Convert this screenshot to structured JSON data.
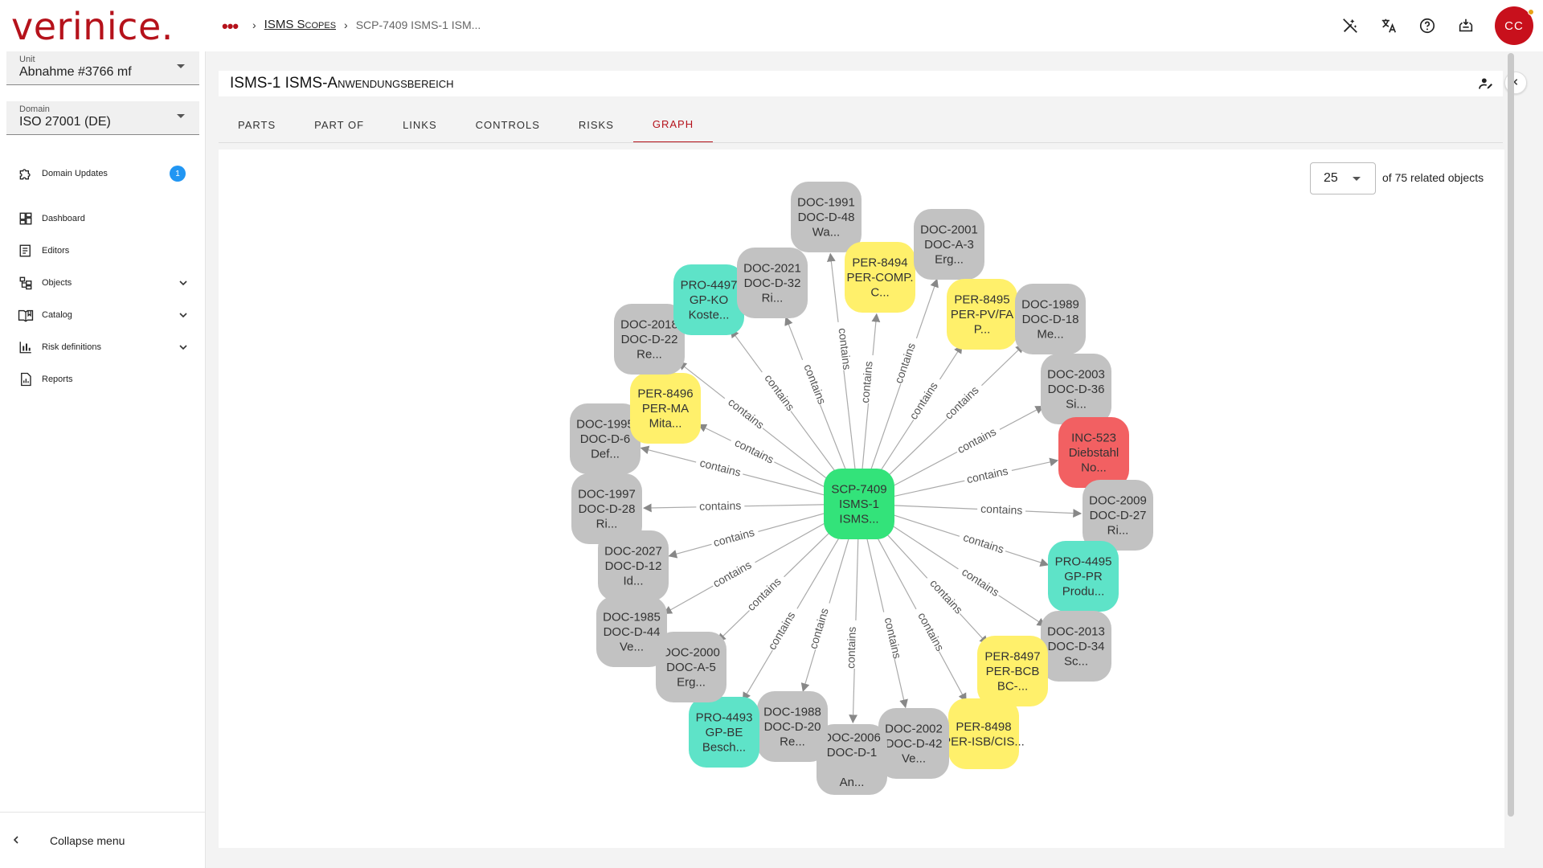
{
  "app": {
    "logo": "verinice."
  },
  "breadcrumb": {
    "menu": "•••",
    "sep1": "›",
    "scopes": "ISMS Scopes",
    "sep2": "›",
    "current": "SCP-7409 ISMS-1 ISM..."
  },
  "user": {
    "initials": "CC"
  },
  "topbar_icons": [
    "magic-off-icon",
    "translate-icon",
    "help-icon",
    "inbox-icon"
  ],
  "sidebar": {
    "unit": {
      "label": "Unit",
      "value": "Abnahme #3766 mf"
    },
    "domain": {
      "label": "Domain",
      "value": "ISO 27001 (DE)"
    },
    "domain_updates": {
      "label": "Domain Updates",
      "badge": "1"
    },
    "items": [
      {
        "label": "Dashboard",
        "icon": "dashboard-icon"
      },
      {
        "label": "Editors",
        "icon": "editors-icon"
      },
      {
        "label": "Objects",
        "icon": "objects-icon"
      },
      {
        "label": "Catalog",
        "icon": "catalog-icon"
      },
      {
        "label": "Risk definitions",
        "icon": "chart-icon"
      },
      {
        "label": "Reports",
        "icon": "reports-icon"
      }
    ],
    "collapse": "Collapse menu"
  },
  "page": {
    "title_prefix": "ISMS-1 ",
    "title_sc": "ISMS-Anwendungsbereich"
  },
  "tabs": [
    "PARTS",
    "PART OF",
    "LINKS",
    "CONTROLS",
    "RISKS",
    "GRAPH"
  ],
  "active_tab": "GRAPH",
  "graph_controls": {
    "page_size": "25",
    "related_text": "of 75 related objects"
  },
  "colors": {
    "center": "#33e37a",
    "document": "#c2c2c2",
    "person": "#fff06b",
    "process": "#5ee3c8",
    "incident": "#f26062",
    "accent": "#b5121b"
  },
  "graph": {
    "edge_label": "contains",
    "center": {
      "lines": [
        "SCP-7409",
        "ISMS-1",
        "ISMS..."
      ]
    },
    "nodes": [
      {
        "lines": [
          "DOC-1991",
          "DOC-D-48",
          "Wa..."
        ],
        "kind": "document"
      },
      {
        "lines": [
          "PER-8494",
          "PER-COMP.",
          "C..."
        ],
        "kind": "person"
      },
      {
        "lines": [
          "DOC-2001",
          "DOC-A-3",
          "Erg..."
        ],
        "kind": "document"
      },
      {
        "lines": [
          "PER-8495",
          "PER-PV/FA",
          "P..."
        ],
        "kind": "person"
      },
      {
        "lines": [
          "DOC-1989",
          "DOC-D-18",
          "Me..."
        ],
        "kind": "document"
      },
      {
        "lines": [
          "DOC-2003",
          "DOC-D-36",
          "Si..."
        ],
        "kind": "document"
      },
      {
        "lines": [
          "INC-523",
          "Diebstahl",
          "No..."
        ],
        "kind": "incident"
      },
      {
        "lines": [
          "DOC-2009",
          "DOC-D-27",
          "Ri..."
        ],
        "kind": "document"
      },
      {
        "lines": [
          "PRO-4495",
          "GP-PR",
          "Produ..."
        ],
        "kind": "process"
      },
      {
        "lines": [
          "DOC-2013",
          "DOC-D-34",
          "Sc..."
        ],
        "kind": "document"
      },
      {
        "lines": [
          "PER-8497",
          "PER-BCB",
          "BC-..."
        ],
        "kind": "person"
      },
      {
        "lines": [
          "PER-8498",
          "PER-ISB/CIS..."
        ],
        "kind": "person"
      },
      {
        "lines": [
          "DOC-2002",
          "DOC-D-42",
          "Ve..."
        ],
        "kind": "document"
      },
      {
        "lines": [
          "DOC-2006",
          "DOC-D-1",
          "",
          "An..."
        ],
        "kind": "document"
      },
      {
        "lines": [
          "DOC-1988",
          "DOC-D-20",
          "Re..."
        ],
        "kind": "document"
      },
      {
        "lines": [
          "PRO-4493",
          "GP-BE",
          "Besch..."
        ],
        "kind": "process"
      },
      {
        "lines": [
          "DOC-2000",
          "DOC-A-5",
          "Erg..."
        ],
        "kind": "document"
      },
      {
        "lines": [
          "DOC-1985",
          "DOC-D-44",
          "Ve..."
        ],
        "kind": "document"
      },
      {
        "lines": [
          "DOC-2027",
          "DOC-D-12",
          "Id..."
        ],
        "kind": "document"
      },
      {
        "lines": [
          "DOC-1997",
          "DOC-D-28",
          "Ri..."
        ],
        "kind": "document"
      },
      {
        "lines": [
          "DOC-1995",
          "DOC-D-6",
          "Def..."
        ],
        "kind": "document"
      },
      {
        "lines": [
          "PER-8496",
          "PER-MA",
          "Mita..."
        ],
        "kind": "person"
      },
      {
        "lines": [
          "DOC-2018",
          "DOC-D-22",
          "Re..."
        ],
        "kind": "document"
      },
      {
        "lines": [
          "PRO-4497",
          "GP-KO",
          "Koste..."
        ],
        "kind": "process"
      },
      {
        "lines": [
          "DOC-2021",
          "DOC-D-32",
          "Ri..."
        ],
        "kind": "document"
      }
    ]
  }
}
